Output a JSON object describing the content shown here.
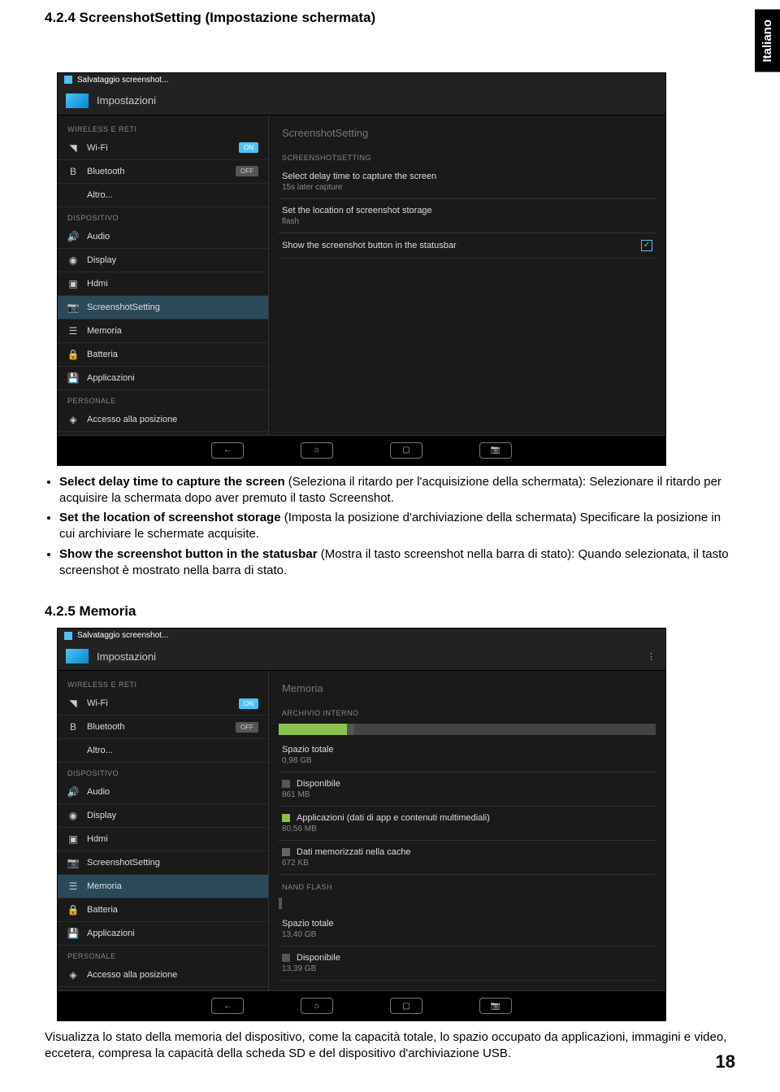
{
  "page": {
    "number": "18"
  },
  "lang_tab": "Italiano",
  "sec1": {
    "heading": "4.2.4  ScreenshotSetting (Impostazione schermata)",
    "bullets": [
      {
        "bold": "Select delay time to capture the screen",
        "rest": " (Seleziona il ritardo per l'acquisizione della schermata): Selezionare il ritardo per acquisire la schermata dopo aver premuto il tasto Screenshot."
      },
      {
        "bold": "Set the location of screenshot storage",
        "rest": " (Imposta la posizione d'archiviazione della schermata) Specificare la posizione in cui archiviare le schermate acquisite."
      },
      {
        "bold": "Show the screenshot button in the statusbar",
        "rest": " (Mostra il tasto screenshot nella barra di stato): Quando selezionata, il tasto screenshot è mostrato nella barra di stato."
      }
    ]
  },
  "sec2": {
    "heading": "4.2.5  Memoria",
    "para": "Visualizza lo stato della memoria del dispositivo, come la capacità totale, lo spazio occupato da applicazioni, immagini e video, eccetera, compresa la capacità della scheda SD e del dispositivo d'archiviazione USB."
  },
  "shot1": {
    "topbar": "Salvataggio screenshot...",
    "app_title": "Impostazioni",
    "sidebar": {
      "cat_wireless": "WIRELESS E RETI",
      "wifi": "Wi-Fi",
      "wifi_state": "ON",
      "bluetooth": "Bluetooth",
      "bt_state": "OFF",
      "more": "Altro...",
      "cat_device": "DISPOSITIVO",
      "audio": "Audio",
      "display": "Display",
      "hdmi": "Hdmi",
      "screenshot": "ScreenshotSetting",
      "memory": "Memoria",
      "battery": "Batteria",
      "apps": "Applicazioni",
      "cat_personal": "PERSONALE",
      "location": "Accesso alla posizione"
    },
    "content": {
      "title": "ScreenshotSetting",
      "cat": "SCREENSHOTSETTING",
      "r1_main": "Select delay time to capture the screen",
      "r1_sub": "15s later capture",
      "r2_main": "Set the location of screenshot storage",
      "r2_sub": "flash",
      "r3_main": "Show the screenshot button in the statusbar"
    }
  },
  "shot2": {
    "topbar": "Salvataggio screenshot...",
    "app_title": "Impostazioni",
    "sidebar": {
      "cat_wireless": "WIRELESS E RETI",
      "wifi": "Wi-Fi",
      "wifi_state": "ON",
      "bluetooth": "Bluetooth",
      "bt_state": "OFF",
      "more": "Altro...",
      "cat_device": "DISPOSITIVO",
      "audio": "Audio",
      "display": "Display",
      "hdmi": "Hdmi",
      "screenshot": "ScreenshotSetting",
      "memory": "Memoria",
      "battery": "Batteria",
      "apps": "Applicazioni",
      "cat_personal": "PERSONALE",
      "location": "Accesso alla posizione"
    },
    "content": {
      "title": "Memoria",
      "cat_int": "ARCHIVIO INTERNO",
      "total_label": "Spazio totale",
      "total_val": "0,98 GB",
      "avail_label": "Disponibile",
      "avail_val": "861 MB",
      "apps_label": "Applicazioni (dati di app e contenuti multimediali)",
      "apps_val": "80,56 MB",
      "cache_label": "Dati memorizzati nella cache",
      "cache_val": "672 KB",
      "cat_nand": "NAND FLASH",
      "nand_total_label": "Spazio totale",
      "nand_total_val": "13,40 GB",
      "nand_avail_label": "Disponibile",
      "nand_avail_val": "13,39 GB"
    }
  }
}
